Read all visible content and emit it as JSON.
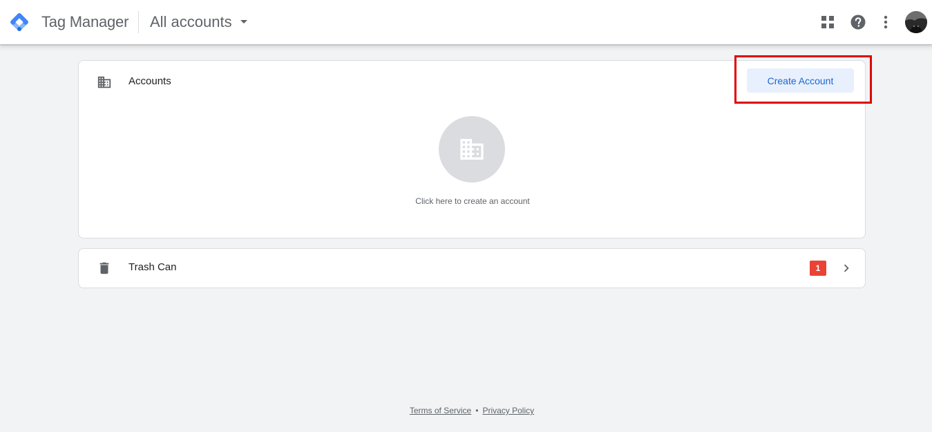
{
  "header": {
    "product_name": "Tag Manager",
    "account_switcher_label": "All accounts",
    "icons": [
      "apps-grid-icon",
      "help-icon",
      "more-vert-icon",
      "avatar"
    ]
  },
  "accounts_card": {
    "title": "Accounts",
    "icon": "domain-building-icon",
    "create_button_label": "Create Account",
    "empty_state_text": "Click here to create an account"
  },
  "trash_card": {
    "title": "Trash Can",
    "icon": "trash-icon",
    "badge_count": "1"
  },
  "footer": {
    "terms_label": "Terms of Service",
    "separator": "•",
    "privacy_label": "Privacy Policy"
  },
  "colors": {
    "background": "#f1f3f4",
    "button_bg": "#e8f0fe",
    "button_text": "#1967d2",
    "badge": "#ea4335",
    "highlight": "#e00000"
  }
}
